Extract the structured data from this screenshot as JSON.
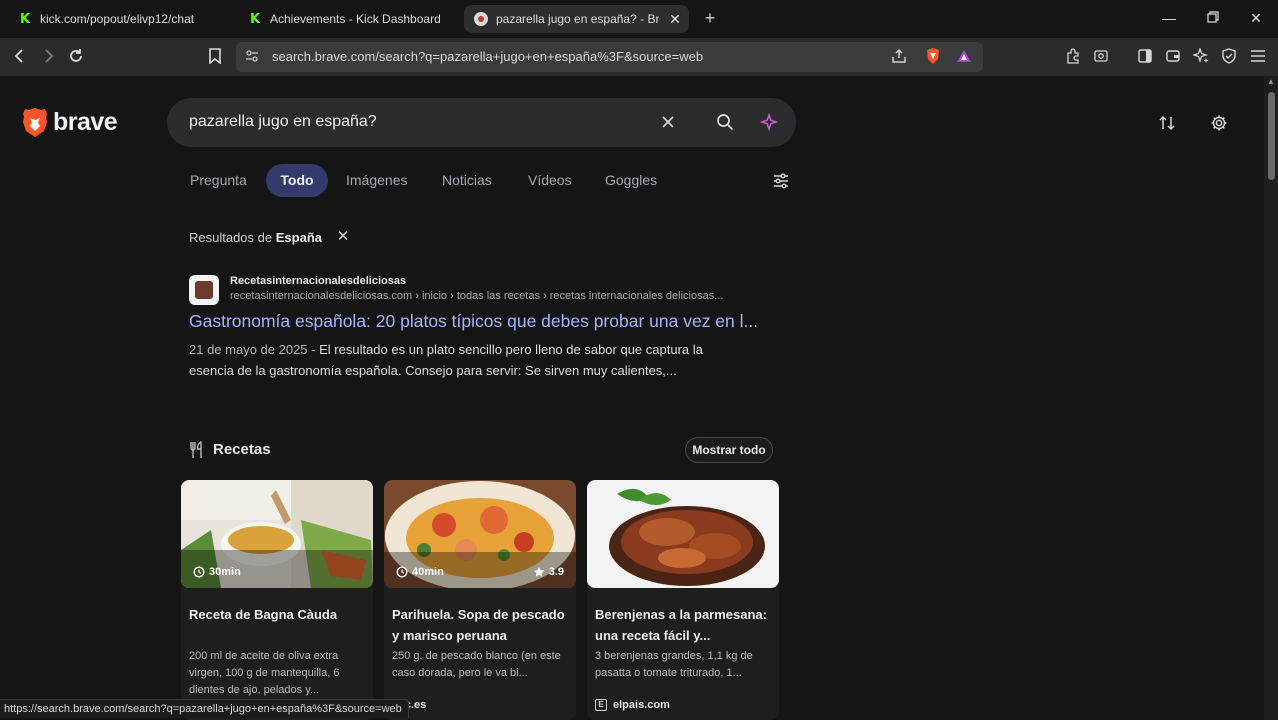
{
  "browser": {
    "tabs": [
      {
        "title": "kick.com/popout/elivp12/chat",
        "favicon": "kick-icon"
      },
      {
        "title": "Achievements - Kick Dashboard",
        "favicon": "kick-icon"
      },
      {
        "title": "pazarella jugo en españa? - Brav",
        "favicon": "brave-search-icon",
        "active": true
      }
    ],
    "url": "search.brave.com/search?q=pazarella+jugo+en+españa%3F&source=web",
    "status_url": "https://search.brave.com/search?q=pazarella+jugo+en+españa%3F&source=web"
  },
  "brand": {
    "logo_text": "brave",
    "accent": "#fb542b"
  },
  "search": {
    "query": "pazarella jugo en españa?"
  },
  "search_tabs": [
    {
      "label": "Pregunta"
    },
    {
      "label": "Todo",
      "active": true
    },
    {
      "label": "Imágenes"
    },
    {
      "label": "Noticias"
    },
    {
      "label": "Vídeos"
    },
    {
      "label": "Goggles"
    }
  ],
  "region": {
    "prefix": "Resultados de",
    "country": "España"
  },
  "result": {
    "site_name": "Recetasinternacionalesdeliciosas",
    "breadcrumb": "recetasinternacionalesdeliciosas.com › inicio › todas las recetas › recetas internacionales deliciosas...",
    "title": "Gastronomía española: 20 platos típicos que debes probar una vez en l...",
    "date": "21 de mayo de 2025 -",
    "snippet": "El resultado es un plato sencillo pero lleno de sabor que captura la esencia de la gastronomía española. Consejo para servir: Se sirven muy calientes,..."
  },
  "recipes": {
    "heading": "Recetas",
    "show_all": "Mostrar todo",
    "cards": [
      {
        "time": "30min",
        "rating": "",
        "title": "Receta de Bagna Càuda",
        "desc": "200 ml de aceite de oliva extra virgen, 100 g de mantequilla, 6 dientes de ajo, pelados y...",
        "source": ""
      },
      {
        "time": "40min",
        "rating": "3.9",
        "title": "Parihuela. Sopa de pescado y marisco peruana",
        "desc": "250 g. de pescado blanco (en este caso dorada, pero le va bi...",
        "source": "abc.es"
      },
      {
        "time": "",
        "rating": "",
        "title": "Berenjenas a la parmesana: una receta fácil y...",
        "desc": "3 berenjenas grandes, 1,1 kg de pasatta o tomate triturado, 1...",
        "source": "elpais.com"
      }
    ]
  }
}
